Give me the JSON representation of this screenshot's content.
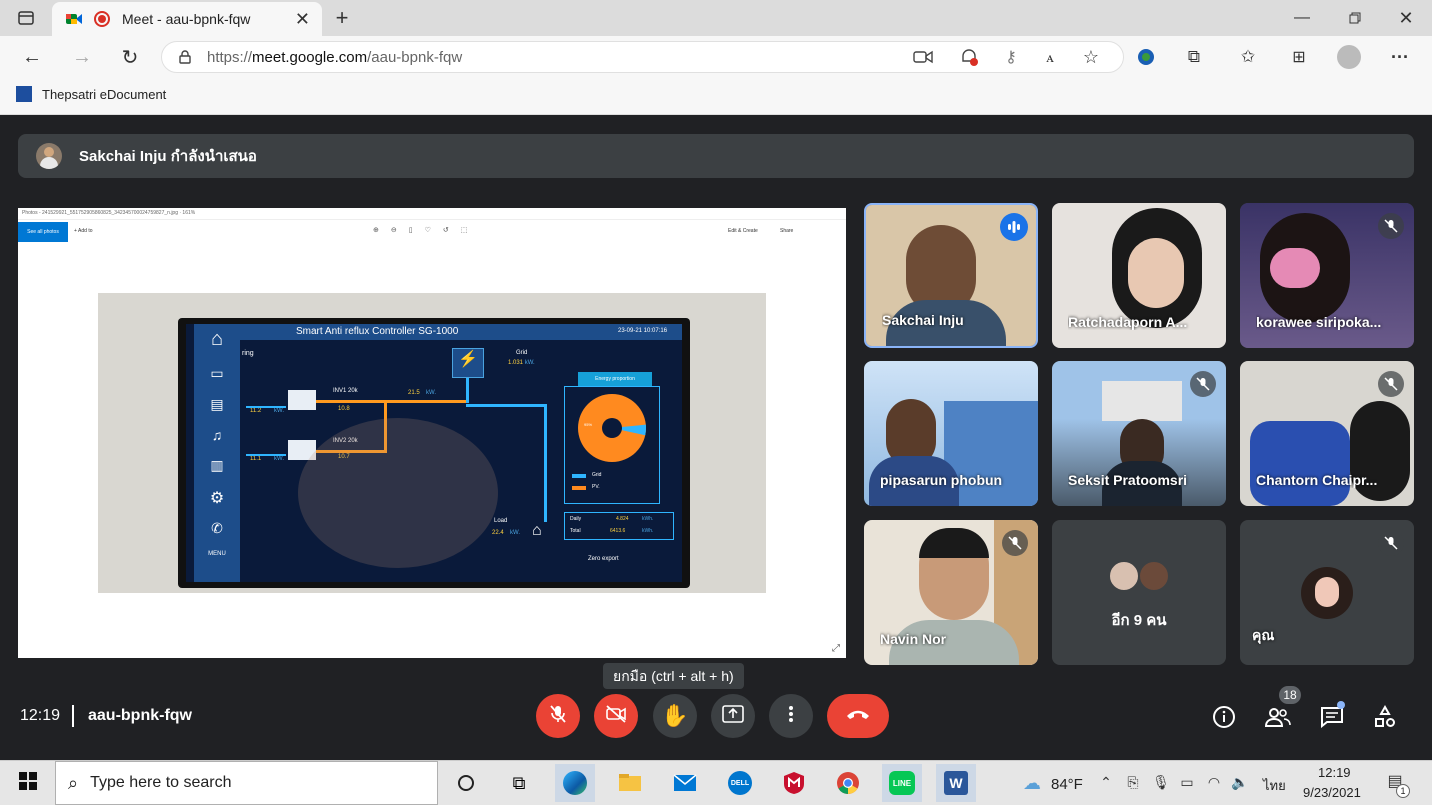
{
  "browser": {
    "tab_title": "Meet - aau-bpnk-fqw",
    "url_prefix": "https://",
    "url_host": "meet.google.com",
    "url_path": "/aau-bpnk-fqw",
    "favorite": "Thepsatri eDocument"
  },
  "meet": {
    "presenter_text": "Sakchai Inju กำลังนำเสนอ",
    "time": "12:19",
    "meeting_code": "aau-bpnk-fqw",
    "tooltip": "ยกมือ (ctrl + alt + h)",
    "participant_count": "18",
    "tiles": [
      {
        "name": "Sakchai Inju",
        "speaking": true
      },
      {
        "name": "Ratchadaporn A..."
      },
      {
        "name": "korawee siripoka..."
      },
      {
        "name": "pipasarun phobun"
      },
      {
        "name": "Seksit Pratoomsri"
      },
      {
        "name": "Chantorn Chaipr..."
      },
      {
        "name": "Navin Nor"
      },
      {
        "name": "อีก 9 คน"
      },
      {
        "name": "คุณ"
      }
    ]
  },
  "shared_screen": {
    "photos_title": "Photos - 241529921_551752905860825_342345700024759827_n.jpg · 161%",
    "see_all": "See all photos",
    "add_to": "+ Add to",
    "edit_create": "Edit & Create",
    "share": "Share",
    "device_title": "Smart Anti reflux Controller SG-1000",
    "device_date": "23-09-21 10:07:16",
    "grid_label": "Grid",
    "grid_value": "1.031",
    "inv1_label": "INV1 20k",
    "inv1_value": "10.8",
    "inv2_label": "INV2 20k",
    "inv2_value": "10.7",
    "pv1": "11.2",
    "pv2": "11.1",
    "flow": "21.5",
    "unit_kw": "kW.",
    "load_label": "Load",
    "load_value": "22.4",
    "energy_title": "Energy proportion",
    "legend_grid": "Grid",
    "legend_pv": "PV.",
    "daily_label": "Daily",
    "daily_value": "4.824",
    "total_label": "Total",
    "total_value": "6413.6",
    "unit_kwh": "kWh.",
    "zero_export": "Zero export",
    "menu": "MENU",
    "ring": "ring",
    "pie_pct": "95%",
    "pie_grid_fraction": 0.05
  },
  "taskbar": {
    "search_placeholder": "Type here to search",
    "weather": "84°F",
    "lang": "ไทย",
    "time": "12:19",
    "date": "9/23/2021",
    "notif_count": "1"
  },
  "colors": {
    "meet_bg": "#202124",
    "red": "#ea4335",
    "blue": "#1a73e8",
    "tile_bg": "#3c4043"
  }
}
